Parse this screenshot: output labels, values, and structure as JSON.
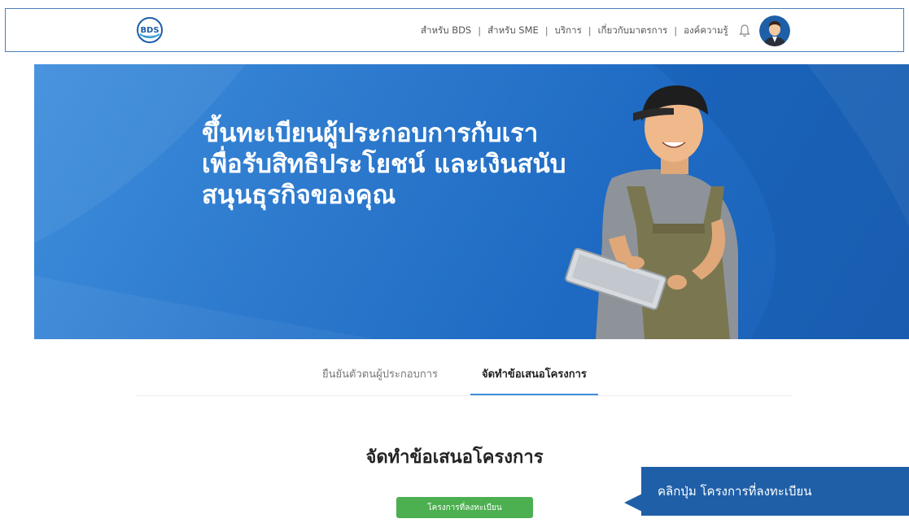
{
  "navbar": {
    "logo_text": "BDS",
    "logo_subtext": "MARKET",
    "links": [
      "สำหรับ BDS",
      "สำหรับ SME",
      "บริการ",
      "เกี่ยวกับมาตรการ",
      "องค์ความรู้"
    ],
    "separator": "|"
  },
  "hero": {
    "title_lines": [
      "ขึ้นทะเบียนผู้ประกอบการกับเรา",
      "เพื่อรับสิทธิประโยชน์ และเงินสนับ",
      "สนุนธุรกิจของคุณ"
    ]
  },
  "tabs": [
    {
      "label": "ยืนยันตัวตนผู้ประกอบการ",
      "active": false
    },
    {
      "label": "จัดทำข้อเสนอโครงการ",
      "active": true
    }
  ],
  "section": {
    "title": "จัดทำข้อเสนอโครงการ",
    "button_label": "โครงการที่ลงทะเบียน"
  },
  "callout": {
    "text": "คลิกปุ่ม โครงการที่ลงทะเบียน"
  },
  "colors": {
    "hero_blue": "#2c79cd",
    "tab_underline": "#3f8edc",
    "button_green": "#4caf50",
    "callout_blue": "#1f5fa8"
  },
  "icons": [
    "bds-logo-icon",
    "bell-icon",
    "user-avatar-icon"
  ]
}
